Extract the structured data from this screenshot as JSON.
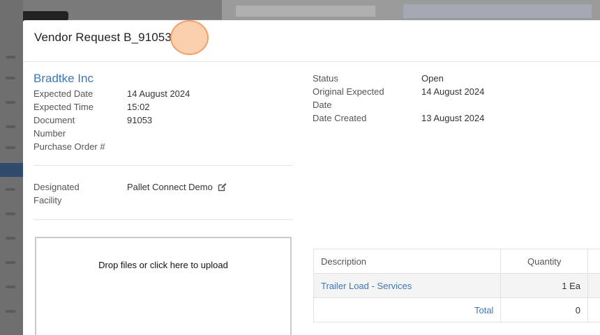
{
  "modal": {
    "title": "Vendor Request B_91053"
  },
  "vendor": {
    "company": "Bradtke Inc",
    "fields": [
      {
        "label": "Expected Date",
        "value": "14 August 2024"
      },
      {
        "label": "Expected Time",
        "value": "15:02"
      },
      {
        "label": "Document",
        "value": "91053"
      },
      {
        "label": "Number",
        "value": ""
      },
      {
        "label": "Purchase Order #",
        "value": ""
      }
    ]
  },
  "facility": {
    "label_line1": "Designated",
    "label_line2": "Facility",
    "value": "Pallet Connect Demo",
    "edit_icon": "edit-icon"
  },
  "status": {
    "fields": [
      {
        "label": "Status",
        "value": "Open"
      },
      {
        "label": "Original Expected",
        "value": "14 August 2024"
      },
      {
        "label": "Date",
        "value": ""
      },
      {
        "label": "Date Created",
        "value": "13 August 2024"
      }
    ]
  },
  "upload": {
    "text": "Drop files or click here to upload"
  },
  "lines_table": {
    "headers": [
      "Description",
      "Quantity"
    ],
    "rows": [
      {
        "description": "Trailer Load - Services",
        "quantity": "1 Ea"
      }
    ],
    "total_label": "Total",
    "total_value": "0"
  },
  "colors": {
    "accent": "#3a78b8",
    "cursor": "#f8b078"
  }
}
